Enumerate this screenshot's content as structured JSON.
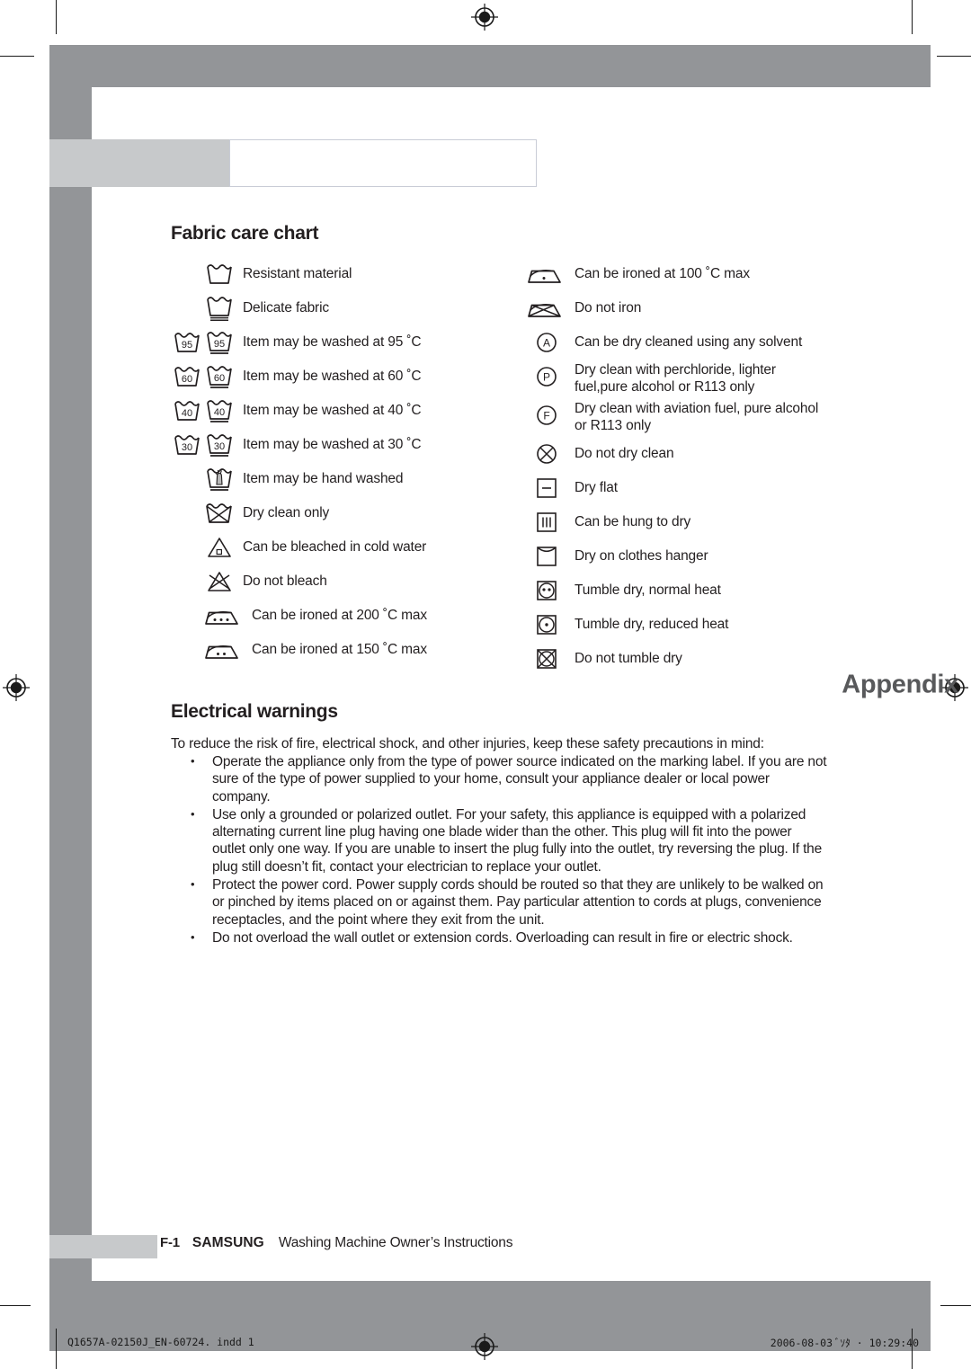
{
  "page": {
    "header_title": "Appendix",
    "section_fabric_title": "Fabric care chart",
    "section_electrical_title": "Electrical warnings"
  },
  "colors": {
    "band_dark": "#939598",
    "band_light": "#c7c9cb",
    "title_gray": "#58595b",
    "ink": "#231f20"
  },
  "fabric_care": {
    "left_column": [
      {
        "icon": "wash-tub-plain",
        "label": "Resistant material"
      },
      {
        "icon": "wash-tub-underline-double",
        "label": "Delicate fabric"
      },
      {
        "icon": "wash-tub-95-pair",
        "label": "Item may be washed at 95 ˚C"
      },
      {
        "icon": "wash-tub-60-pair",
        "label": "Item may be washed at 60 ˚C"
      },
      {
        "icon": "wash-tub-40-pair",
        "label": "Item may be washed at 40 ˚C"
      },
      {
        "icon": "wash-tub-30-pair",
        "label": "Item may be washed at 30 ˚C"
      },
      {
        "icon": "hand-wash",
        "label": "Item may be hand washed"
      },
      {
        "icon": "dry-clean-only-tub-crossed",
        "label": "Dry clean only"
      },
      {
        "icon": "bleach-cold-water-triangle",
        "label": "Can be bleached in cold water"
      },
      {
        "icon": "do-not-bleach-triangle-crossed",
        "label": "Do not bleach"
      },
      {
        "icon": "iron-three-dots",
        "label": "Can be ironed at 200 ˚C max"
      },
      {
        "icon": "iron-two-dots",
        "label": "Can be ironed at 150 ˚C max"
      }
    ],
    "right_column": [
      {
        "icon": "iron-one-dot",
        "label": "Can be ironed at 100 ˚C max"
      },
      {
        "icon": "do-not-iron-crossed",
        "label": "Do not iron"
      },
      {
        "icon": "dryclean-circle-a",
        "label": "Can be dry cleaned using any solvent"
      },
      {
        "icon": "dryclean-circle-p",
        "label": "Dry clean with perchloride, lighter fuel,pure alcohol or R113 only"
      },
      {
        "icon": "dryclean-circle-f",
        "label": "Dry clean with aviation fuel, pure alcohol or R113 only"
      },
      {
        "icon": "do-not-dryclean-circle-crossed",
        "label": "Do not dry clean"
      },
      {
        "icon": "dry-flat-square-dash",
        "label": "Dry flat"
      },
      {
        "icon": "hang-to-dry-square-bars",
        "label": "Can be hung to dry"
      },
      {
        "icon": "drip-dry-square-arc",
        "label": "Dry on clothes hanger"
      },
      {
        "icon": "tumble-dry-two-dots",
        "label": "Tumble dry, normal heat"
      },
      {
        "icon": "tumble-dry-one-dot",
        "label": "Tumble dry, reduced heat"
      },
      {
        "icon": "do-not-tumble-dry-crossed",
        "label": "Do not tumble dry"
      }
    ]
  },
  "electrical_warnings": {
    "intro": "To reduce the risk of fire, electrical shock, and other injuries, keep these safety precautions in mind:",
    "bullets": [
      "Operate the appliance only from the type of power source indicated on the marking label. If you are not sure of the type of power supplied to your home, consult your appliance dealer or local power company.",
      "Use only a grounded or polarized outlet. For your safety, this appliance is equipped with a polarized alternating current line plug having one blade wider than the other. This plug will fit into the power outlet only one way. If you are unable to insert the plug fully into the outlet, try reversing the plug. If the plug still doesn’t fit, contact your electrician to replace your outlet.",
      "Protect the power cord. Power supply cords should be routed so that they are unlikely to be walked on or pinched by items placed on or against them. Pay particular attention to cords at plugs, convenience receptacles, and the point where they exit from the unit.",
      "Do not overload the wall outlet or extension cords. Overloading can result in fire or electric shock."
    ]
  },
  "footer": {
    "page_number": "F-1",
    "brand": "SAMSUNG",
    "description": "Washing Machine Owner’s Instructions"
  },
  "print_info": {
    "filename": "Q1657A-02150J_EN-60724. indd   1",
    "timestamp": "2006-08-03   ﾞｿﾀ · 10:29:40"
  }
}
